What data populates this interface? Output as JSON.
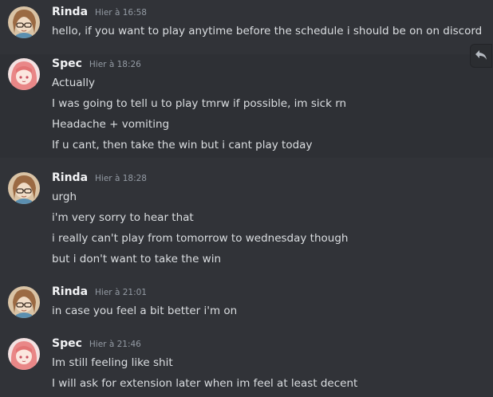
{
  "messages": [
    {
      "username": "Rinda",
      "timestamp": "Hier à 16:58",
      "lines": [
        "hello, if you want to play anytime before the schedule i should be on on discord"
      ]
    },
    {
      "username": "Spec",
      "timestamp": "Hier à 18:26",
      "lines": [
        "Actually",
        "I was going to tell u to play tmrw if possible, im sick rn",
        "Headache + vomiting",
        "If u cant, then take the win but i cant play today"
      ]
    },
    {
      "username": "Rinda",
      "timestamp": "Hier à 18:28",
      "lines": [
        "urgh",
        "i'm very sorry to hear that",
        "i really can't play from tomorrow to wednesday though",
        "but i don't want to take the win"
      ]
    },
    {
      "username": "Rinda",
      "timestamp": "Hier à 21:01",
      "lines": [
        "in case you feel a bit better i'm on"
      ]
    },
    {
      "username": "Spec",
      "timestamp": "Hier à 21:46",
      "lines": [
        "Im still feeling like shit",
        "I will ask for extension later when im feel at least decent"
      ]
    }
  ],
  "icons": {
    "reply": "reply-icon"
  },
  "colors": {
    "background": "#313338",
    "hover": "#2e3035",
    "username": "#f2f3f5",
    "text": "#dbdee1",
    "timestamp": "#949ba4"
  }
}
